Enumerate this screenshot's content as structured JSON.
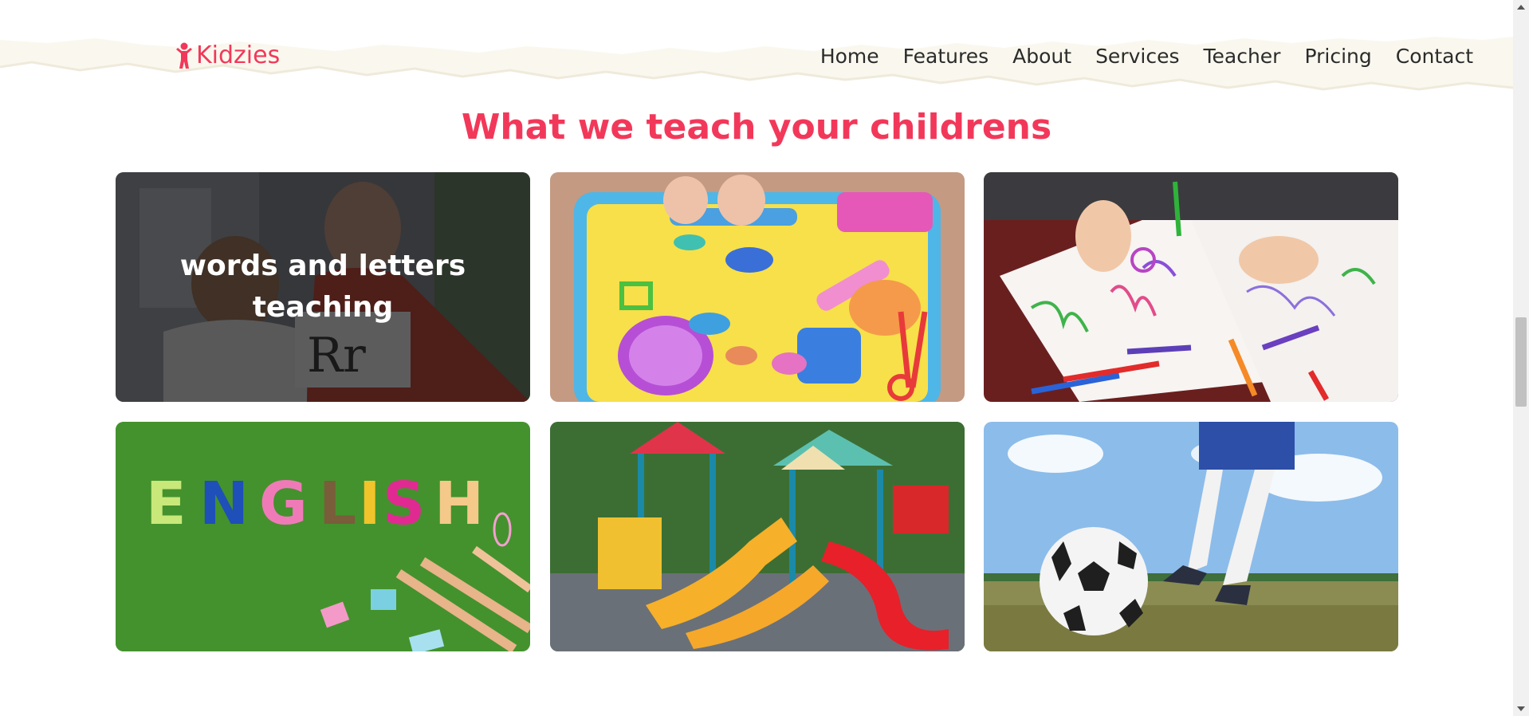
{
  "brand": {
    "name": "Kidzies",
    "logo_icon": "child-figure-icon",
    "color": "#f2385a"
  },
  "nav": {
    "items": [
      {
        "label": "Home"
      },
      {
        "label": "Features"
      },
      {
        "label": "About"
      },
      {
        "label": "Services"
      },
      {
        "label": "Teacher"
      },
      {
        "label": "Pricing"
      },
      {
        "label": "Contact"
      }
    ]
  },
  "section": {
    "title": "What we teach your childrens",
    "cards": [
      {
        "caption": "words and letters teaching",
        "image": "teacher-showing-letter-card-photo"
      },
      {
        "caption": "",
        "image": "play-dough-tray-photo"
      },
      {
        "caption": "",
        "image": "children-drawing-photo"
      },
      {
        "caption": "",
        "image": "english-letters-on-grass-photo"
      },
      {
        "caption": "",
        "image": "playground-slides-photo"
      },
      {
        "caption": "",
        "image": "child-kicking-soccer-ball-photo"
      }
    ]
  },
  "colors": {
    "accent": "#f2385a",
    "header_band": "#faf8ee",
    "text": "#2b2b2b"
  }
}
